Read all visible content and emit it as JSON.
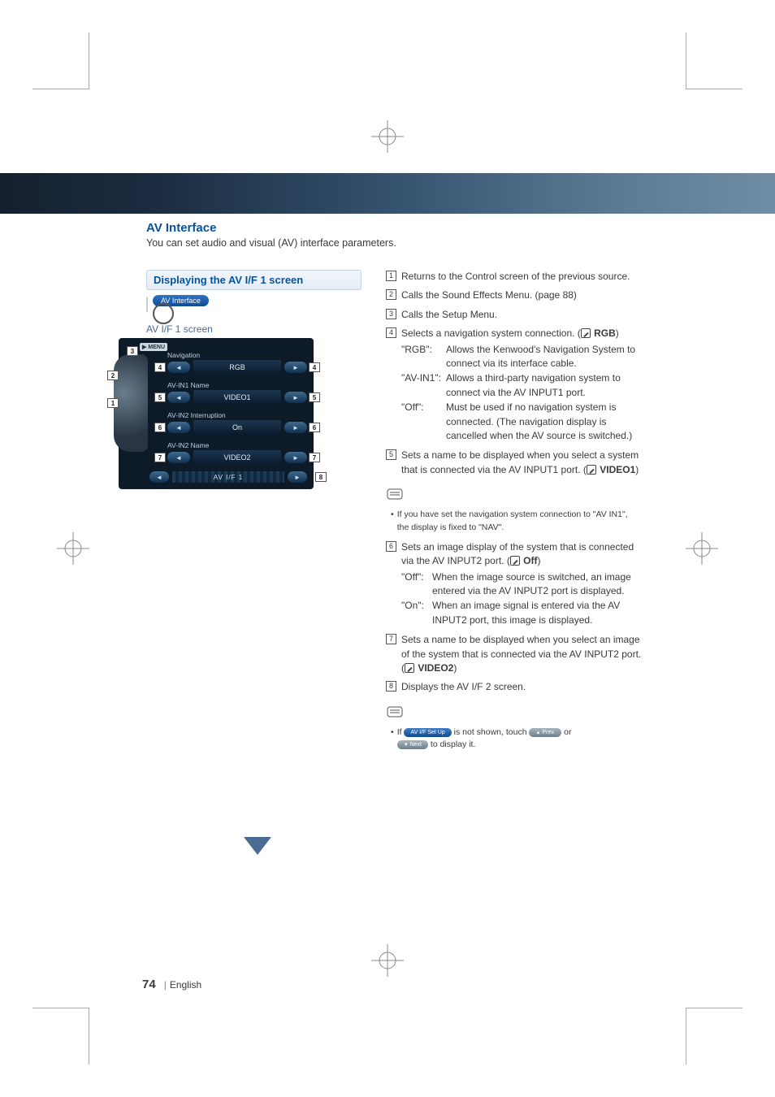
{
  "page": {
    "number": "74",
    "language": "English"
  },
  "section": {
    "title": "AV Interface",
    "subtitle": "You can set audio and visual (AV) interface parameters."
  },
  "left": {
    "subhead": "Displaying the AV I/F 1 screen",
    "pill": "AV Interface",
    "caption": "AV I/F 1 screen",
    "screen": {
      "menu": "MENU",
      "rows": [
        {
          "label": "Navigation",
          "value": "RGB"
        },
        {
          "label": "AV-IN1 Name",
          "value": "VIDEO1"
        },
        {
          "label": "AV-IN2 Interruption",
          "value": "On"
        },
        {
          "label": "AV-IN2 Name",
          "value": "VIDEO2"
        }
      ],
      "footer_title": "AV I/F 1"
    }
  },
  "items": {
    "i1": "Returns to the Control screen of the previous source.",
    "i2": "Calls the Sound Effects Menu. (page 88)",
    "i3": "Calls the Setup Menu.",
    "i4": {
      "lead": "Selects a navigation system connection. (",
      "default": "RGB",
      "tail": ")",
      "defs": [
        {
          "k": "\"RGB\":",
          "v": "Allows the Kenwood's Navigation System to connect via its interface cable."
        },
        {
          "k": "\"AV-IN1\":",
          "v": "Allows a third-party navigation system to connect via the AV INPUT1 port."
        },
        {
          "k": "\"Off\":",
          "v": "Must be used if no navigation system is connected. (The navigation display is cancelled when the AV source is switched.)"
        }
      ]
    },
    "i5": {
      "lead": "Sets a name to be displayed when you select a system that is connected via the AV INPUT1 port. (",
      "default": "VIDEO1",
      "tail": ")"
    },
    "note5": "If you have set the navigation system connection to \"AV IN1\", the display is fixed to \"NAV\".",
    "i6": {
      "lead": "Sets an image display of the system that is connected via the AV INPUT2 port. (",
      "default": "Off",
      "tail": ")",
      "defs": [
        {
          "k": "\"Off\":",
          "v": "When the image source is switched, an image entered via the AV INPUT2 port is displayed."
        },
        {
          "k": "\"On\":",
          "v": "When an image signal is entered via the AV INPUT2 port, this image is displayed."
        }
      ]
    },
    "i7": {
      "lead": "Sets a name to be displayed when you select an image of the system that is connected via the AV INPUT2 port. (",
      "default": "VIDEO2",
      "tail": ")"
    },
    "i8": "Displays the AV I/F 2 screen.",
    "note8": {
      "pre": "If ",
      "p1": "AV I/F Set Up",
      "mid": " is not shown, touch ",
      "p2": "Prev.",
      "or": " or ",
      "p3": "Next",
      "post": " to display it."
    }
  }
}
